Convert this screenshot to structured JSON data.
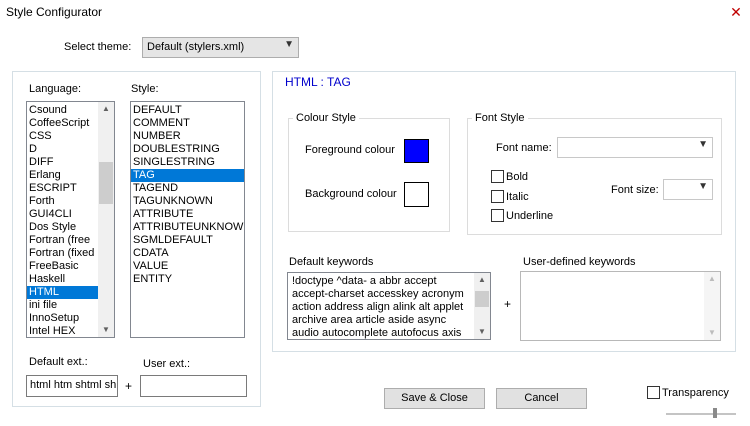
{
  "window": {
    "title": "Style Configurator",
    "close_glyph": "✕"
  },
  "theme": {
    "label": "Select theme:",
    "value": "Default (stylers.xml)"
  },
  "language": {
    "label": "Language:",
    "items": [
      "Csound",
      "CoffeeScript",
      "CSS",
      "D",
      "DIFF",
      "Erlang",
      "ESCRIPT",
      "Forth",
      "GUI4CLI",
      "Dos Style",
      "Fortran (free",
      "Fortran (fixed",
      "FreeBasic",
      "Haskell",
      "HTML",
      "ini file",
      "InnoSetup",
      "Intel HEX"
    ],
    "selected": "HTML"
  },
  "style": {
    "label": "Style:",
    "items": [
      "DEFAULT",
      "COMMENT",
      "NUMBER",
      "DOUBLESTRING",
      "SINGLESTRING",
      "TAG",
      "TAGEND",
      "TAGUNKNOWN",
      "ATTRIBUTE",
      "ATTRIBUTEUNKNOWN",
      "SGMLDEFAULT",
      "CDATA",
      "VALUE",
      "ENTITY"
    ],
    "selected": "TAG"
  },
  "ext": {
    "default_label": "Default ext.:",
    "default_value": "html htm shtml sh",
    "plus": "+",
    "user_label": "User ext.:",
    "user_value": ""
  },
  "heading": "HTML : TAG",
  "colour_style": {
    "title": "Colour Style",
    "foreground_label": "Foreground colour",
    "foreground_color": "#0000ff",
    "background_label": "Background colour",
    "background_color": "#ffffff"
  },
  "font_style": {
    "title": "Font Style",
    "name_label": "Font name:",
    "name_value": "",
    "bold_label": "Bold",
    "italic_label": "Italic",
    "underline_label": "Underline",
    "size_label": "Font size:",
    "size_value": ""
  },
  "keywords": {
    "default_label": "Default keywords",
    "default_text": "!doctype ^data- a abbr accept accept-charset accesskey acronym action address align alink alt applet archive area article aside async audio autocomplete autofocus axis",
    "plus": "+",
    "user_label": "User-defined keywords",
    "user_text": ""
  },
  "buttons": {
    "save": "Save & Close",
    "cancel": "Cancel"
  },
  "transparency": {
    "label": "Transparency",
    "checked": false
  }
}
